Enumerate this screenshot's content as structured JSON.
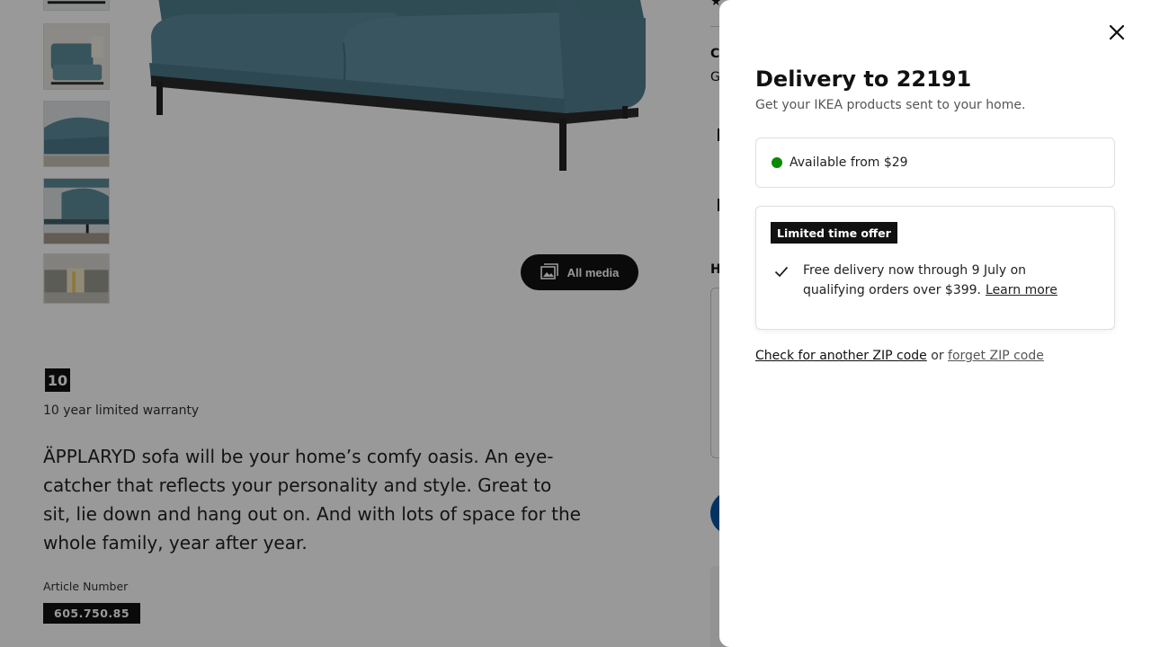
{
  "product_page": {
    "all_media_label": "All media",
    "warranty_years": "10",
    "warranty_text": "10 year limited warranty",
    "description": "ÄPPLARYD sofa will be your home’s comfy oasis. An eye-catcher that reflects your personality and style. Great to sit, lie down and hang out on. And with lots of space for the whole family, year after year.",
    "article_label": "Article Number",
    "article_number": "605.750.85",
    "right_col_text1": "C",
    "right_col_text2": "G",
    "right_col_text3": "H"
  },
  "delivery_panel": {
    "title": "Delivery to 22191",
    "subtitle": "Get your IKEA products sent to your home.",
    "availability": "Available from $29",
    "offer_badge": "Limited time offer",
    "offer_text": "Free delivery now through 9 July on qualifying orders over $399.",
    "learn_more": "Learn more",
    "check_zip": "Check for another ZIP code",
    "or": "or",
    "forget_zip": "forget ZIP code"
  },
  "colors": {
    "available_dot": "#0a8a00",
    "overlay": "rgba(0,0,0,0.4)",
    "sofa": "#5d8a9a"
  }
}
